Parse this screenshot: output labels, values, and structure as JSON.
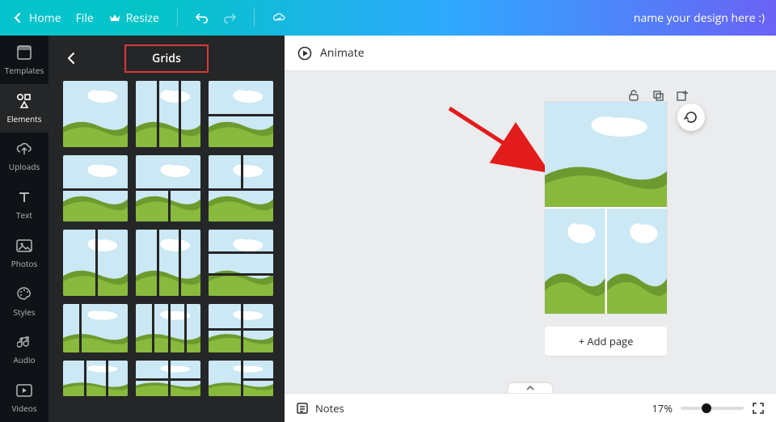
{
  "topbar": {
    "home": "Home",
    "file": "File",
    "resize": "Resize",
    "design_name": "name your design here :)"
  },
  "rail": {
    "items": [
      {
        "id": "templates",
        "label": "Templates"
      },
      {
        "id": "elements",
        "label": "Elements"
      },
      {
        "id": "uploads",
        "label": "Uploads"
      },
      {
        "id": "text",
        "label": "Text"
      },
      {
        "id": "photos",
        "label": "Photos"
      },
      {
        "id": "styles",
        "label": "Styles"
      },
      {
        "id": "audio",
        "label": "Audio"
      },
      {
        "id": "videos",
        "label": "Videos"
      }
    ],
    "active": "elements"
  },
  "panel": {
    "title": "Grids"
  },
  "canvas": {
    "animate_label": "Animate",
    "add_page_label": "+ Add page"
  },
  "footer": {
    "notes_label": "Notes",
    "zoom_text": "17%"
  },
  "colors": {
    "sky": "#cbe8f4",
    "grass_dark": "#6c9a2e",
    "grass_light": "#89b93d",
    "cloud": "#ffffff"
  }
}
